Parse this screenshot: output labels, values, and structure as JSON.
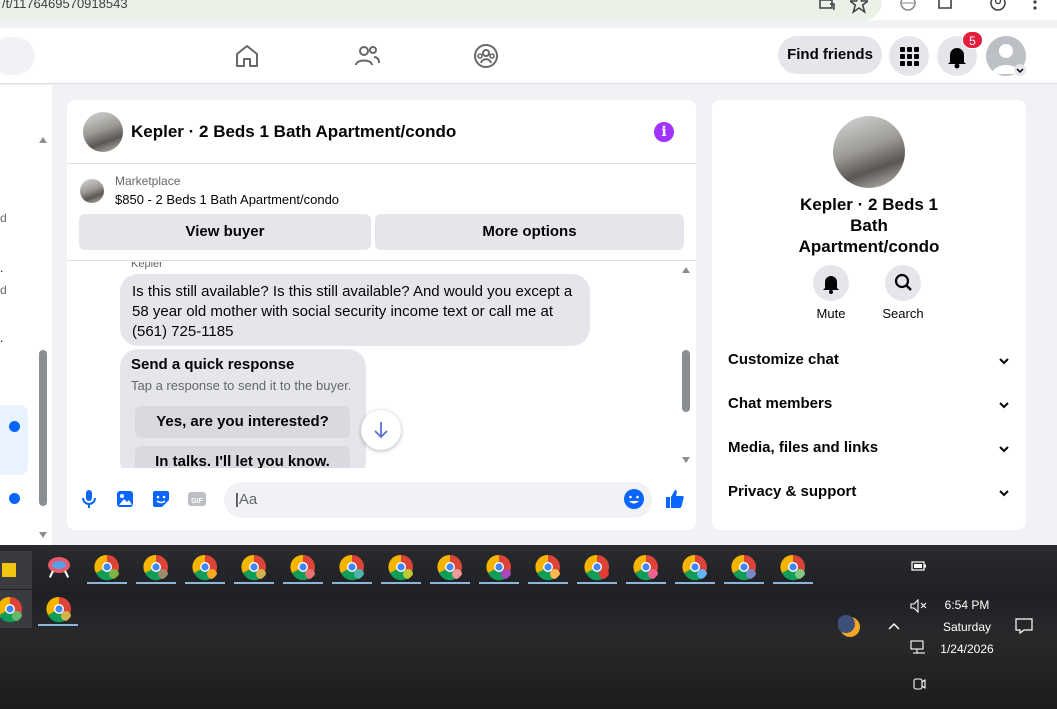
{
  "browser": {
    "url": "/t/1176469570918543"
  },
  "fb_header": {
    "find_friends_label": "Find friends",
    "notification_count": "5"
  },
  "chat": {
    "title": "Kepler · 2 Beds 1 Bath Apartment/condo",
    "marketplace_label": "Marketplace",
    "listing_line": "$850 - 2 Beds 1 Bath Apartment/condo",
    "view_buyer_label": "View buyer",
    "more_options_label": "More options",
    "sender_name": "Kepler",
    "message_text": "Is this still available? Is this still available? And would you except a 58 year old mother with social security income text or call me at (561) 725-1185",
    "quick_response_title": "Send a quick response",
    "quick_response_subtitle": "Tap a response to send it to the buyer.",
    "quick_replies": [
      "Yes, are you interested?",
      "In talks. I'll let you know."
    ],
    "input_placeholder": "Aa"
  },
  "info_panel": {
    "name": "Kepler · 2 Beds 1 Bath Apartment/condo",
    "mute_label": "Mute",
    "search_label": "Search",
    "sections": [
      "Customize chat",
      "Chat members",
      "Media, files and links",
      "Privacy & support"
    ]
  },
  "taskbar": {
    "time": "6:54 PM",
    "day": "Saturday",
    "date": "1/24/2026"
  },
  "colors": {
    "accent": "#0866ff",
    "info_icon": "#a033ff",
    "badge": "#e41e3f"
  }
}
